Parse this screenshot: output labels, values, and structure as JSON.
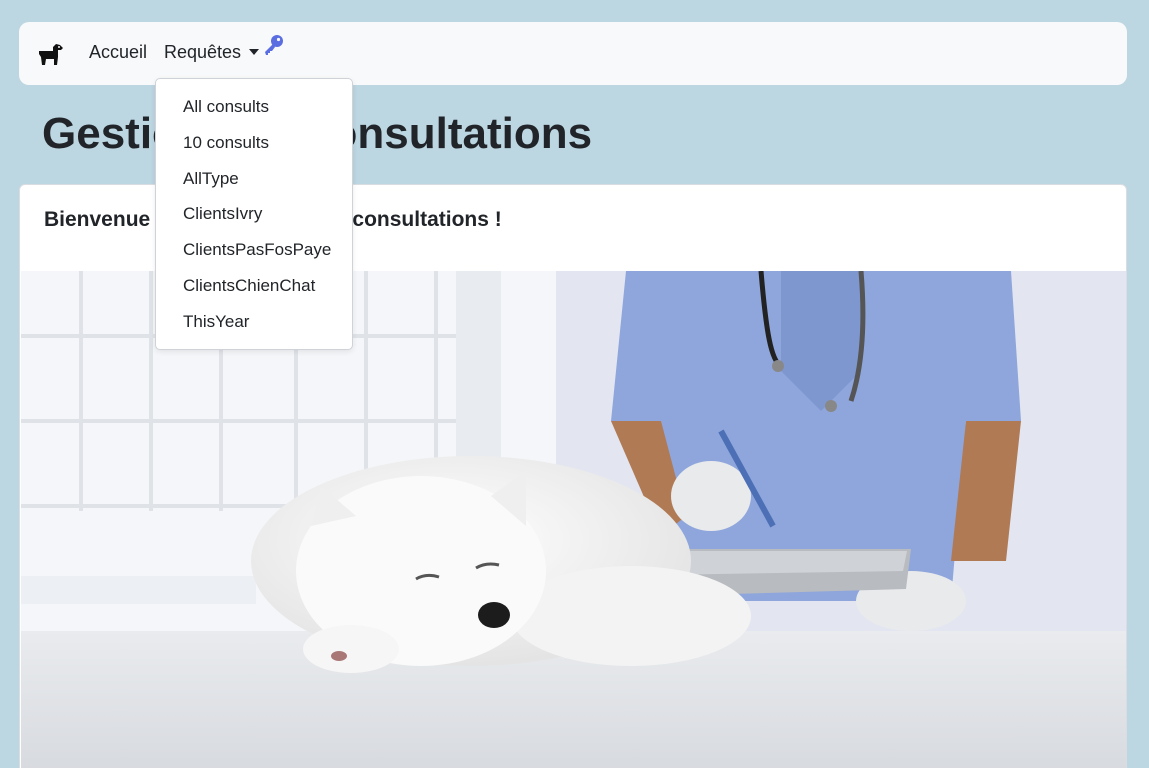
{
  "navbar": {
    "brand_icon": "dog-icon",
    "home_label": "Accueil",
    "requests_label": "Requêtes",
    "key_icon": "key-icon",
    "key_color": "#5b6ee1"
  },
  "dropdown": {
    "items": [
      "All consults",
      "10 consults",
      "AllType",
      "ClientsIvry",
      "ClientsPasFosPaye",
      "ClientsChienChat",
      "ThisYear"
    ]
  },
  "page": {
    "title": "Gestion des consultations",
    "background": "#bcd6e2"
  },
  "card": {
    "title": "Bienvenue sur l'application de consultations !",
    "hero_image": "veterinarian-with-sleeping-white-dog"
  }
}
